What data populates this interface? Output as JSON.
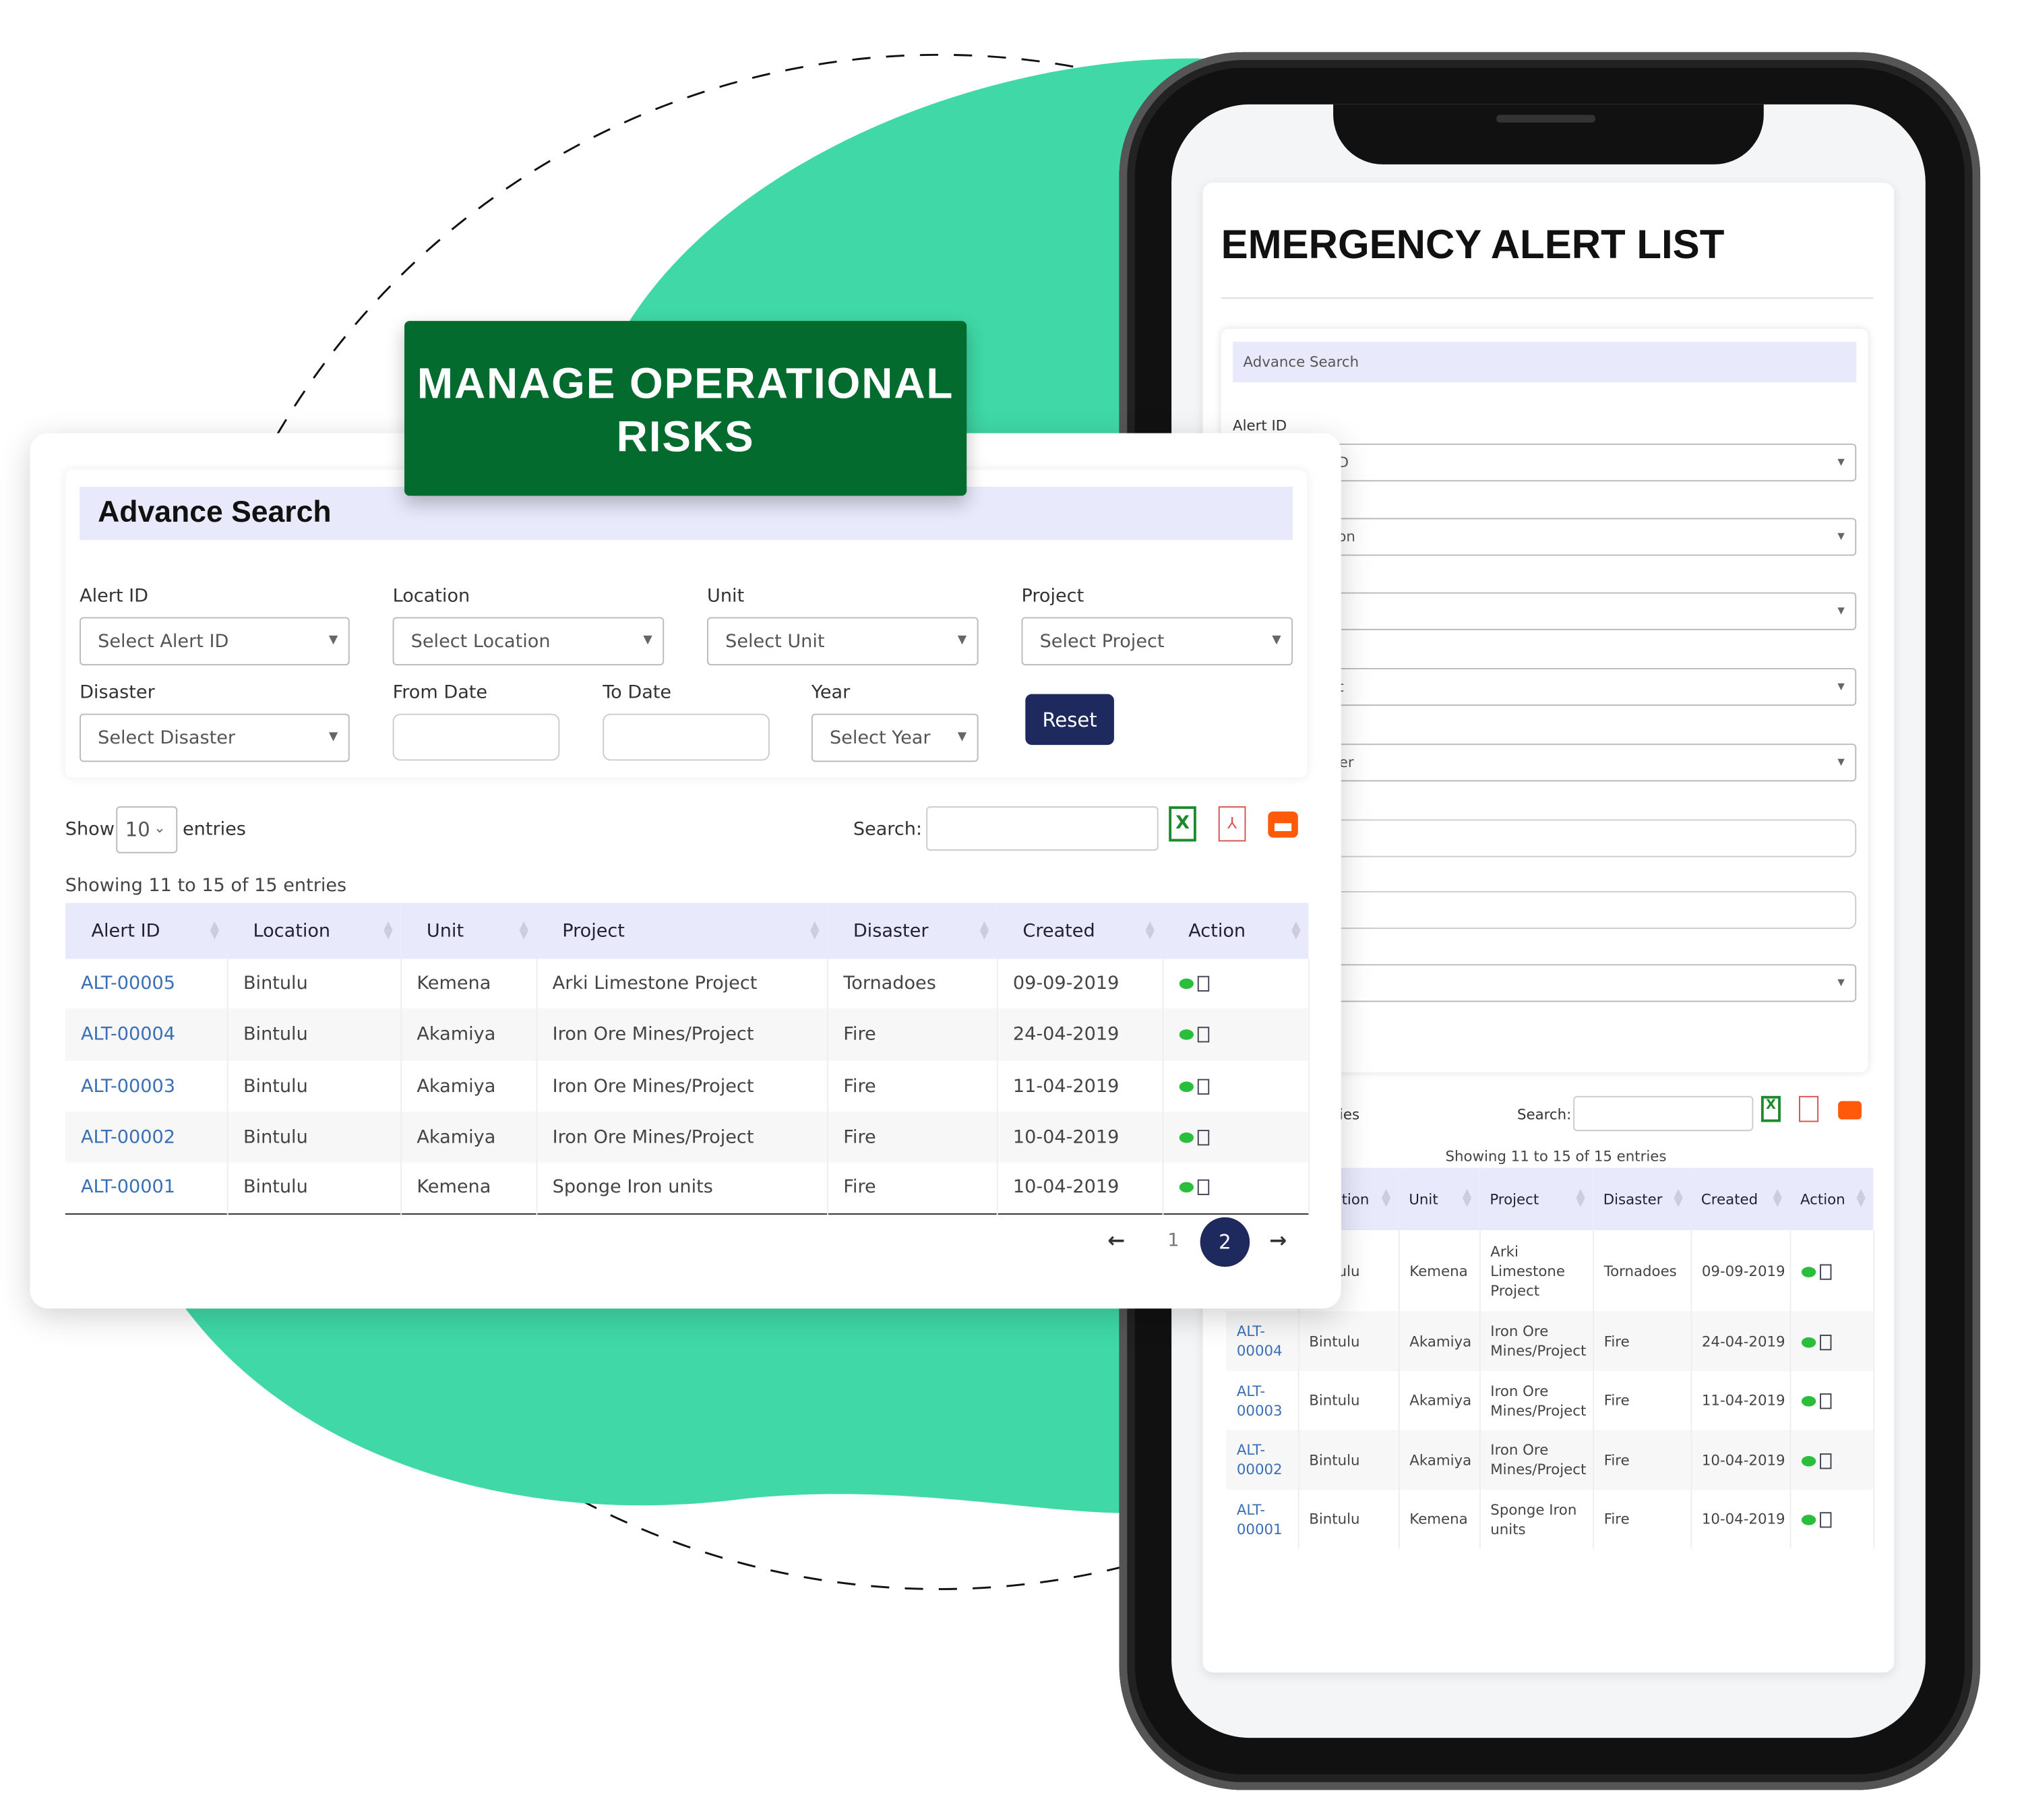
{
  "colors": {
    "blob": "#3fd8a6",
    "banner": "#036b2e",
    "header_bg": "#e8eafc",
    "reset": "#1e2a5e",
    "link": "#3a6fb5",
    "excel": "#1f8a2d",
    "pdf": "#d9534f",
    "print": "#ff5a0a",
    "eye": "#2bbd3c"
  },
  "banner": {
    "line1": "MANAGE OPERATIONAL",
    "line2": "RISKS"
  },
  "panel": {
    "advance_search": "Advance Search",
    "fields": [
      {
        "label": "Alert ID",
        "placeholder": "Select Alert ID"
      },
      {
        "label": "Location",
        "placeholder": "Select Location"
      },
      {
        "label": "Unit",
        "placeholder": "Select Unit"
      },
      {
        "label": "Project",
        "placeholder": "Select Project"
      },
      {
        "label": "Disaster",
        "placeholder": "Select Disaster"
      },
      {
        "label": "From Date",
        "placeholder": ""
      },
      {
        "label": "To Date",
        "placeholder": ""
      },
      {
        "label": "Year",
        "placeholder": "Select Year"
      }
    ],
    "reset_label": "Reset",
    "show_label": "Show",
    "entries_value": "10",
    "entries_label": "entries",
    "search_label": "Search:",
    "info": "Showing 11 to 15 of 15 entries",
    "columns": [
      "Alert ID",
      "Location",
      "Unit",
      "Project",
      "Disaster",
      "Created",
      "Action"
    ],
    "rows": [
      [
        "ALT-00005",
        "Bintulu",
        "Kemena",
        "Arki Limestone Project",
        "Tornadoes",
        "09-09-2019"
      ],
      [
        "ALT-00004",
        "Bintulu",
        "Akamiya",
        "Iron Ore Mines/Project",
        "Fire",
        "24-04-2019"
      ],
      [
        "ALT-00003",
        "Bintulu",
        "Akamiya",
        "Iron Ore Mines/Project",
        "Fire",
        "11-04-2019"
      ],
      [
        "ALT-00002",
        "Bintulu",
        "Akamiya",
        "Iron Ore Mines/Project",
        "Fire",
        "10-04-2019"
      ],
      [
        "ALT-00001",
        "Bintulu",
        "Kemena",
        "Sponge Iron units",
        "Fire",
        "10-04-2019"
      ]
    ],
    "pagination": {
      "prev": "←",
      "pages": [
        "1",
        "2"
      ],
      "current": "2",
      "next": "→"
    }
  },
  "phone": {
    "title": "EMERGENCY ALERT LIST",
    "advance_search": "Advance Search",
    "first_label": "Alert ID",
    "search_label": "Search:",
    "entries_label": "entries",
    "info": "Showing 11 to 15 of 15 entries"
  }
}
